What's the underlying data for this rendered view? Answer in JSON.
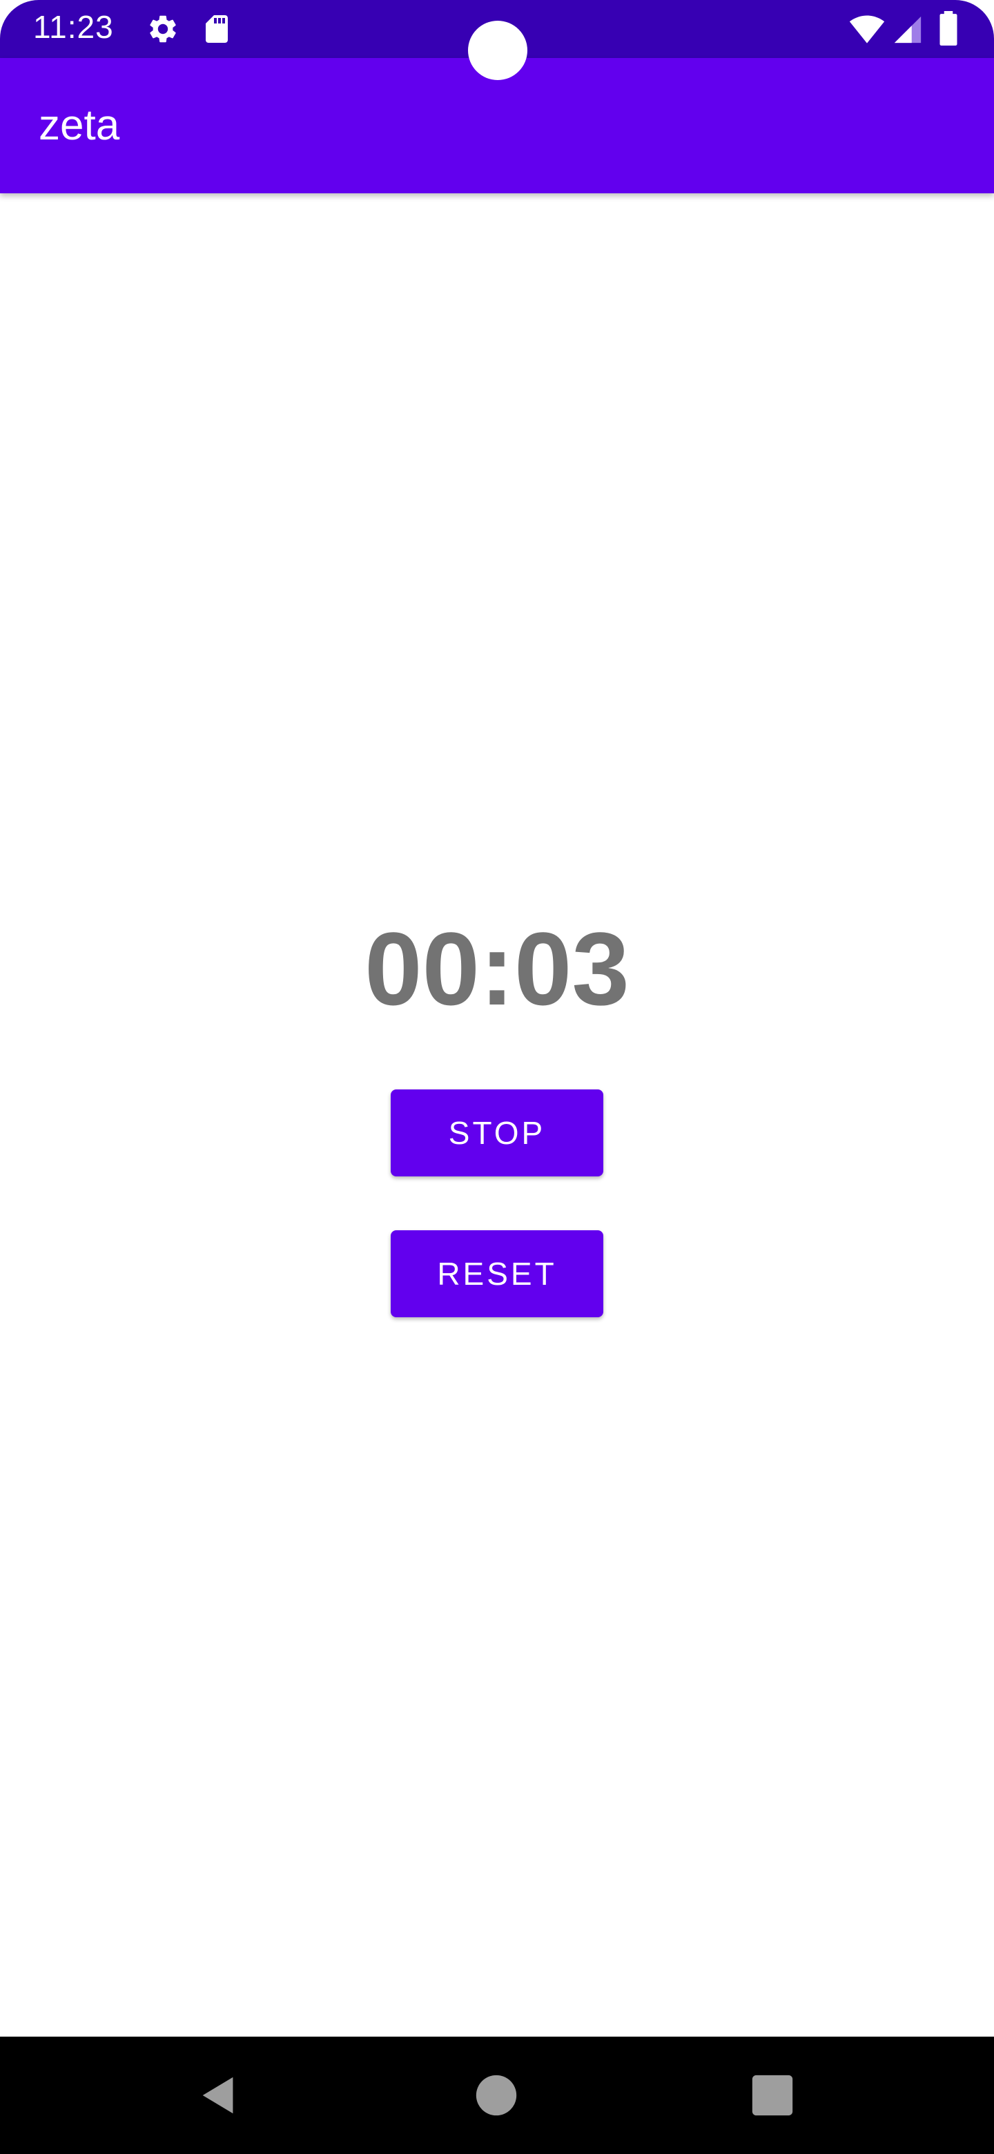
{
  "status_bar": {
    "time": "11:23",
    "left_icons": [
      "gear-icon",
      "sd-card-icon"
    ],
    "right_icons": [
      "wifi-icon",
      "signal-icon",
      "battery-icon"
    ],
    "background": "#3700b3"
  },
  "app_bar": {
    "title": "zeta",
    "background": "#6200ee"
  },
  "stopwatch": {
    "elapsed": "00:03",
    "stop_label": "STOP",
    "reset_label": "RESET",
    "accent": "#6200ee",
    "time_color": "#737373"
  },
  "nav_bar": {
    "buttons": [
      "back-icon",
      "home-icon",
      "recents-icon"
    ]
  }
}
